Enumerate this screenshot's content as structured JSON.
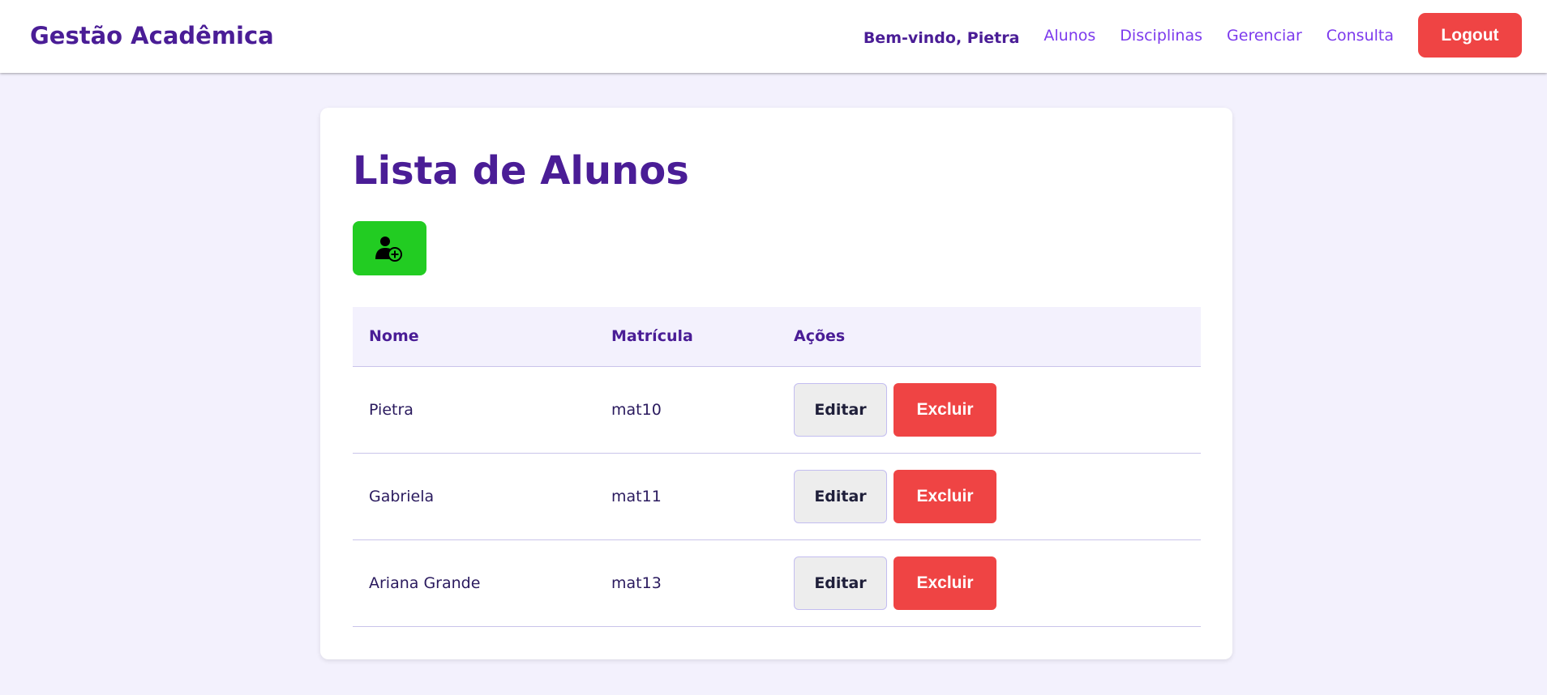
{
  "header": {
    "brand": "Gestão Acadêmica",
    "welcome": "Bem-vindo, Pietra",
    "links": [
      "Alunos",
      "Disciplinas",
      "Gerenciar",
      "Consulta"
    ],
    "logout_label": "Logout"
  },
  "main": {
    "title": "Lista de Alunos",
    "add_button_icon": "user-plus-icon",
    "table": {
      "headers": [
        "Nome",
        "Matrícula",
        "Ações"
      ],
      "rows": [
        {
          "nome": "Pietra",
          "matricula": "mat10",
          "edit_label": "Editar",
          "delete_label": "Excluir"
        },
        {
          "nome": "Gabriela",
          "matricula": "mat11",
          "edit_label": "Editar",
          "delete_label": "Excluir"
        },
        {
          "nome": "Ariana Grande",
          "matricula": "mat13",
          "edit_label": "Editar",
          "delete_label": "Excluir"
        }
      ]
    }
  },
  "colors": {
    "primary": "#4a1d96",
    "link": "#7c3aed",
    "danger": "#ef4444",
    "success": "#22cc22",
    "background": "#f3f1fd"
  }
}
